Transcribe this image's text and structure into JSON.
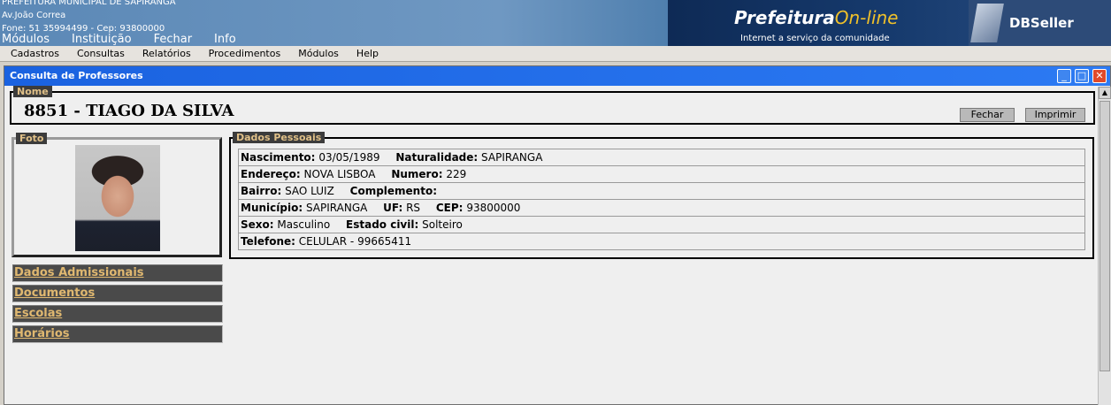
{
  "header": {
    "org_name": "PREFEITURA MUNICIPAL DE SAPIRANGA",
    "address": "Av.João Correa",
    "contact": "Fone: 51 35994499  -  Cep: 93800000",
    "menu": [
      "Módulos",
      "Instituição",
      "Fechar",
      "Info"
    ],
    "logo_main": "Prefeitura",
    "logo_online": "On-line",
    "logo_sub": "Internet a serviço da comunidade",
    "brand": "DBSeller"
  },
  "menubar": [
    "Cadastros",
    "Consultas",
    "Relatórios",
    "Procedimentos",
    "Módulos",
    "Help"
  ],
  "window": {
    "title": "Consulta de Professores",
    "min_glyph": "_",
    "max_glyph": "□",
    "close_glyph": "✕"
  },
  "nome": {
    "legend": "Nome",
    "value": "8851  -  TIAGO DA SILVA",
    "fechar": "Fechar",
    "imprimir": "Imprimir"
  },
  "foto": {
    "legend": "Foto"
  },
  "links": [
    "Dados Admissionais",
    "Documentos",
    "Escolas",
    "Horários"
  ],
  "dados": {
    "legend": "Dados Pessoais",
    "nascimento_label": "Nascimento:",
    "nascimento": "03/05/1989",
    "naturalidade_label": "Naturalidade:",
    "naturalidade": "SAPIRANGA",
    "endereco_label": "Endereço:",
    "endereco": "NOVA LISBOA",
    "numero_label": "Numero:",
    "numero": "229",
    "bairro_label": "Bairro:",
    "bairro": "SAO LUIZ",
    "complemento_label": "Complemento:",
    "complemento": "",
    "municipio_label": "Município:",
    "municipio": "SAPIRANGA",
    "uf_label": "UF:",
    "uf": "RS",
    "cep_label": "CEP:",
    "cep": "93800000",
    "sexo_label": "Sexo:",
    "sexo": "Masculino",
    "estado_civil_label": "Estado civil:",
    "estado_civil": "Solteiro",
    "telefone_label": "Telefone:",
    "telefone": "CELULAR - 99665411"
  }
}
